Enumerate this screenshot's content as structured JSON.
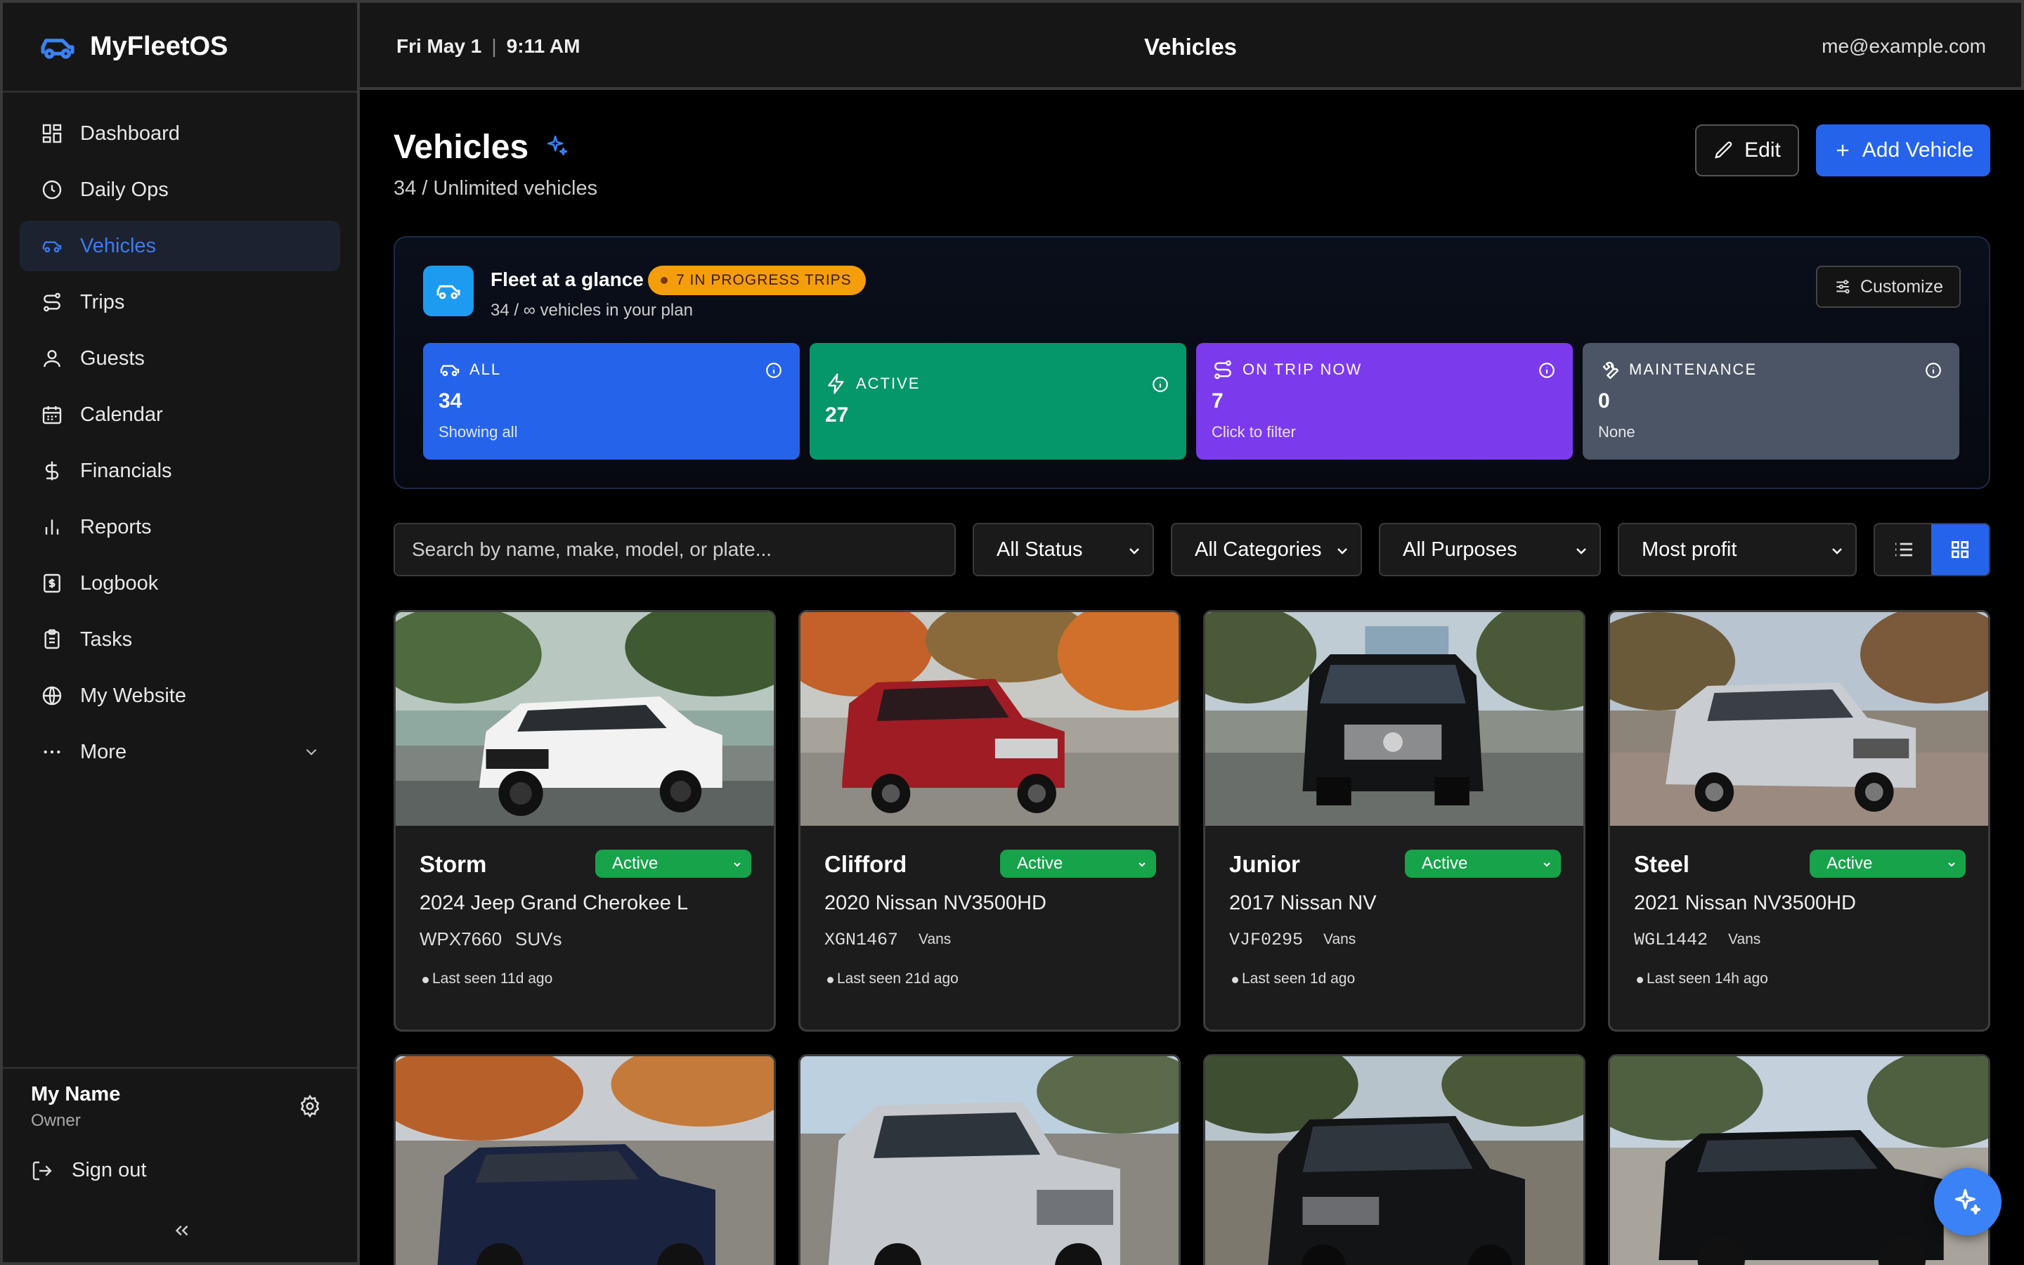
{
  "app": {
    "name": "MyFleetOS"
  },
  "topbar": {
    "date": "Fri May 1",
    "time": "9:11 AM",
    "title": "Vehicles",
    "email": "me@example.com"
  },
  "sidebar": {
    "items": [
      {
        "label": "Dashboard",
        "icon": "dashboard-icon"
      },
      {
        "label": "Daily Ops",
        "icon": "clock-icon"
      },
      {
        "label": "Vehicles",
        "icon": "car-icon",
        "active": true
      },
      {
        "label": "Trips",
        "icon": "route-icon"
      },
      {
        "label": "Guests",
        "icon": "user-icon"
      },
      {
        "label": "Calendar",
        "icon": "calendar-icon"
      },
      {
        "label": "Financials",
        "icon": "dollar-icon"
      },
      {
        "label": "Reports",
        "icon": "bar-chart-icon"
      },
      {
        "label": "Logbook",
        "icon": "logbook-icon"
      },
      {
        "label": "Tasks",
        "icon": "clipboard-icon"
      },
      {
        "label": "My Website",
        "icon": "globe-icon"
      },
      {
        "label": "More",
        "icon": "ellipsis-icon"
      }
    ],
    "user": {
      "name": "My Name",
      "role": "Owner"
    },
    "signout": "Sign out"
  },
  "header": {
    "title": "Vehicles",
    "subtitle": "34 / Unlimited vehicles",
    "edit_label": "Edit",
    "add_label": "Add Vehicle"
  },
  "glance": {
    "title": "Fleet at a glance",
    "badge": "7 IN PROGRESS TRIPS",
    "subtitle": "34 / ∞ vehicles in your plan",
    "customize_label": "Customize",
    "stats": {
      "all": {
        "label": "ALL",
        "value": "34",
        "note": "Showing all"
      },
      "active": {
        "label": "ACTIVE",
        "value": "27"
      },
      "trip": {
        "label": "ON TRIP NOW",
        "value": "7",
        "note": "Click to filter"
      },
      "maint": {
        "label": "MAINTENANCE",
        "value": "0",
        "note": "None"
      }
    }
  },
  "filters": {
    "search_placeholder": "Search by name, make, model, or plate...",
    "status": "All Status",
    "categories": "All Categories",
    "purposes": "All Purposes",
    "sort": "Most profit"
  },
  "vehicles": [
    {
      "name": "Storm",
      "status": "Active",
      "model": "2024 Jeep Grand Cherokee L",
      "plate": "WPX7660",
      "category": "SUVs",
      "seen": "Last seen 11d ago"
    },
    {
      "name": "Clifford",
      "status": "Active",
      "model": "2020 Nissan NV3500HD",
      "plate": "XGN1467",
      "category": "Vans",
      "seen": "Last seen 21d ago"
    },
    {
      "name": "Junior",
      "status": "Active",
      "model": "2017 Nissan NV",
      "plate": "VJF0295",
      "category": "Vans",
      "seen": "Last seen 1d ago"
    },
    {
      "name": "Steel",
      "status": "Active",
      "model": "2021 Nissan NV3500HD",
      "plate": "WGL1442",
      "category": "Vans",
      "seen": "Last seen 14h ago"
    }
  ],
  "colors": {
    "accent": "#2563eb",
    "active": "#16a34a",
    "badge": "#f59e0b",
    "trip": "#7c3aed",
    "maintenance": "#4b5566"
  }
}
